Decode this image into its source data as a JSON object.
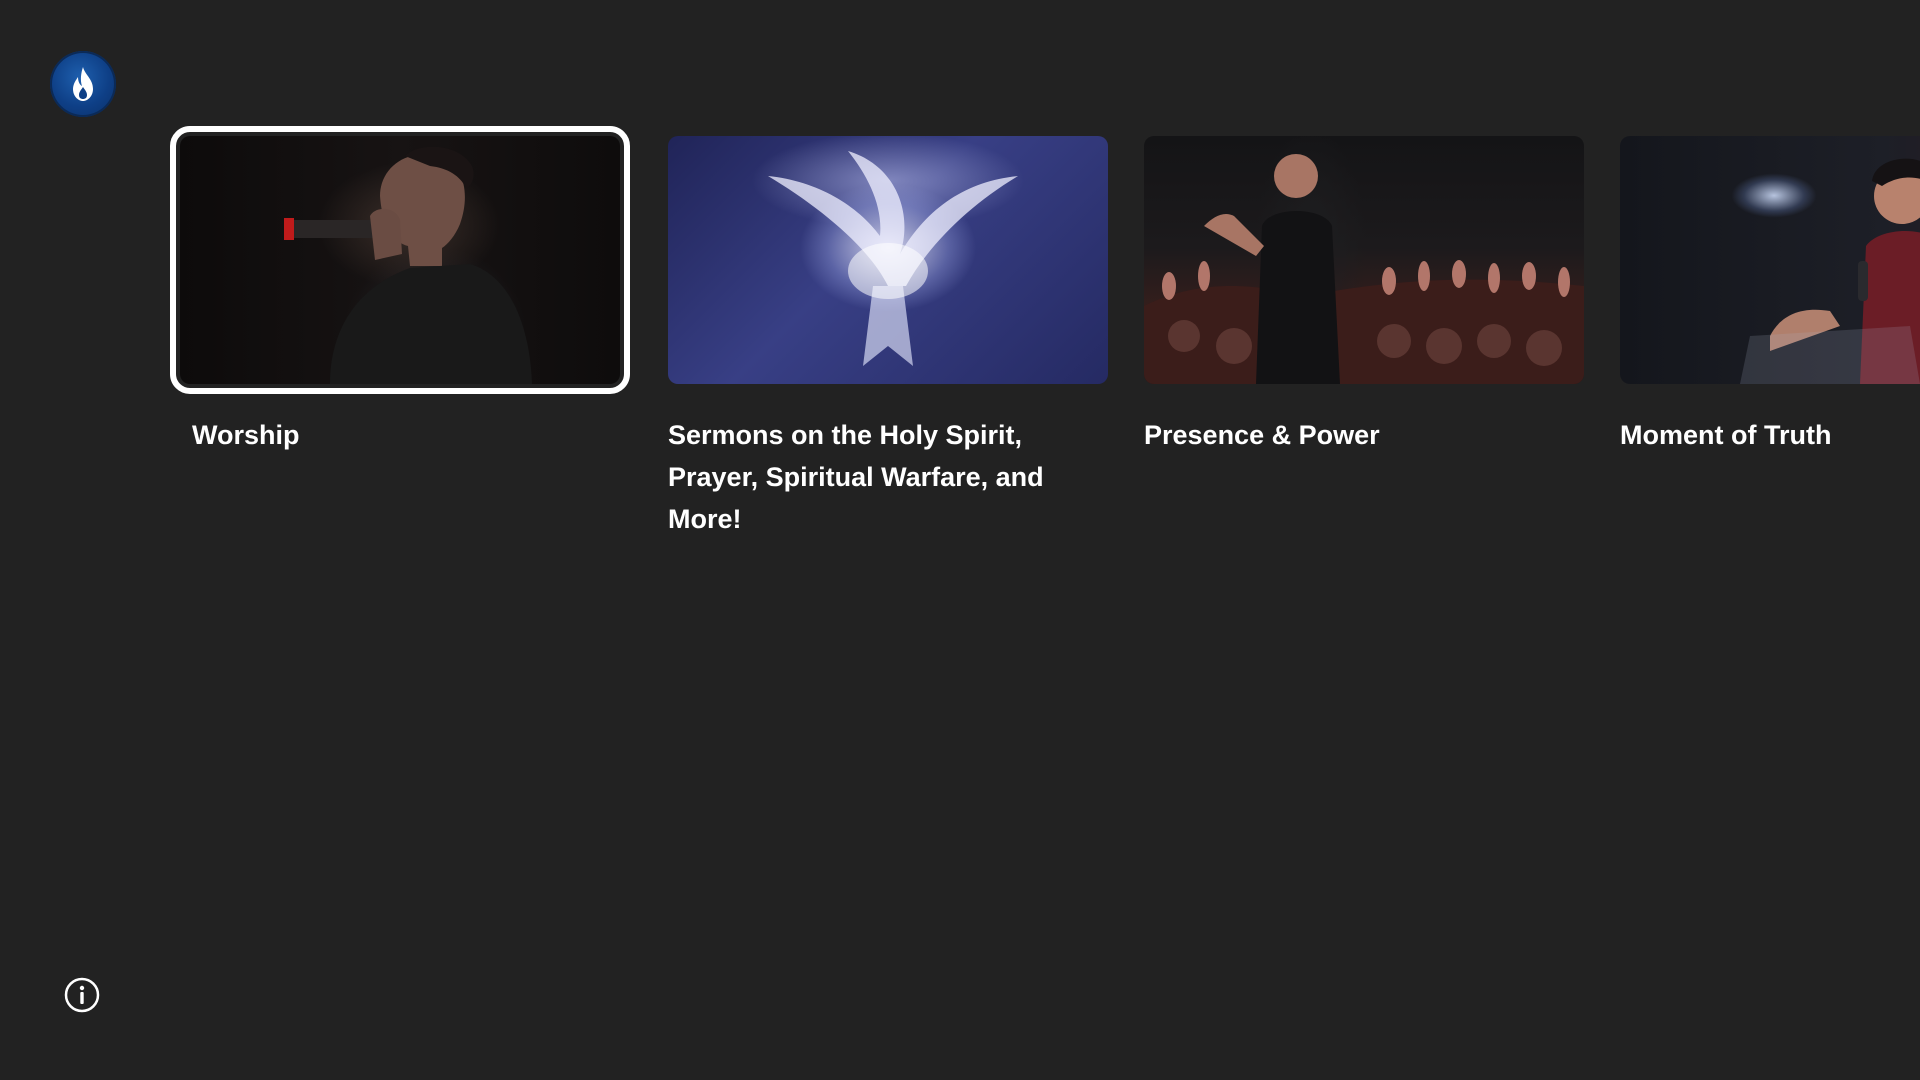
{
  "app": {
    "logo_icon": "flame-drop-logo-icon",
    "logo_color": "#0e3f86",
    "background_color": "#222222",
    "focus_color": "#ffffff"
  },
  "row": {
    "items": [
      {
        "title": "Worship",
        "thumbnail": "singer-with-microphone",
        "focused": true
      },
      {
        "title": "Sermons on the Holy Spirit, Prayer, Spiritual Warfare, and More!",
        "thumbnail": "glowing-dove",
        "focused": false
      },
      {
        "title": "Presence & Power",
        "thumbnail": "preacher-with-crowd",
        "focused": false
      },
      {
        "title": "Moment of Truth",
        "thumbnail": "speaker-with-microphone",
        "focused": false
      }
    ]
  },
  "footer": {
    "info_icon": "info-icon"
  }
}
